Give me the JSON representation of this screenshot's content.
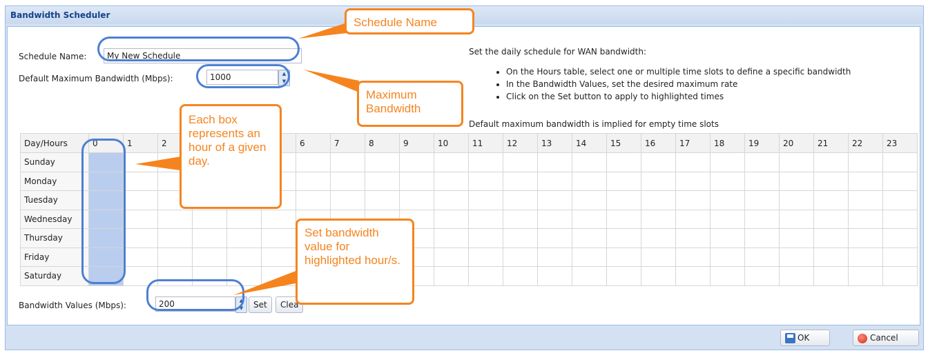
{
  "dialog": {
    "title": "Bandwidth Scheduler"
  },
  "form": {
    "schedule_name_label": "Schedule Name:",
    "schedule_name_value": "My New Schedule",
    "default_bw_label": "Default Maximum Bandwidth (Mbps):",
    "default_bw_value": "1000"
  },
  "help": {
    "intro": "Set the daily schedule for WAN bandwidth:",
    "bullets": [
      "On the Hours table, select one or multiple time slots to define a specific bandwidth",
      "In the Bandwidth Values, set the desired maximum rate",
      "Click on the Set button to apply to highlighted times"
    ],
    "footnote": "Default maximum bandwidth is implied for empty time slots"
  },
  "grid": {
    "corner_header": "Day/Hours",
    "hours": [
      "0",
      "1",
      "2",
      "3",
      "4",
      "5",
      "6",
      "7",
      "8",
      "9",
      "10",
      "11",
      "12",
      "13",
      "14",
      "15",
      "16",
      "17",
      "18",
      "19",
      "20",
      "21",
      "22",
      "23"
    ],
    "days": [
      "Sunday",
      "Monday",
      "Tuesday",
      "Wednesday",
      "Thursday",
      "Friday",
      "Saturday"
    ],
    "selected_hour": "0"
  },
  "bandwidth_values": {
    "label": "Bandwidth Values (Mbps):",
    "value": "200",
    "set_label": "Set",
    "clear_label": "Clea"
  },
  "footer": {
    "ok_label": "OK",
    "cancel_label": "Cancel"
  },
  "callouts": {
    "schedule_name": "Schedule Name",
    "max_bandwidth": "Maximum Bandwidth",
    "each_box": "Each box represents an hour of a given day.",
    "set_bandwidth": "Set bandwidth value for highlighted hour/s."
  },
  "colors": {
    "accent_orange": "#f5841f",
    "highlight_blue": "#4d7fd3",
    "selected_cell": "#b9cdee"
  }
}
